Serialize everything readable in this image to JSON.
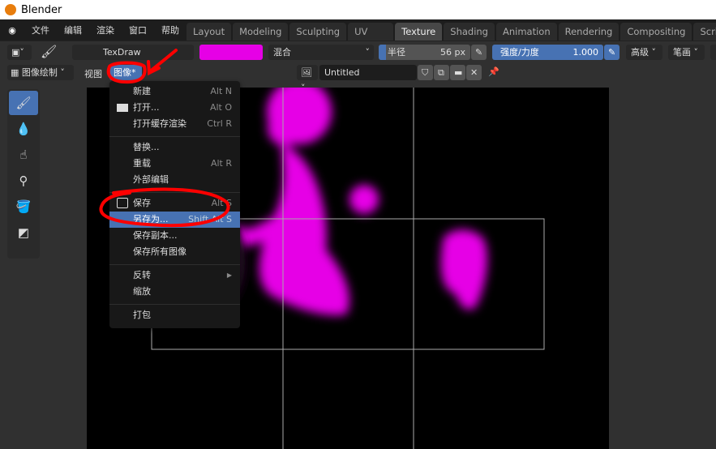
{
  "window": {
    "title": "Blender"
  },
  "menubar": [
    "文件",
    "编辑",
    "渲染",
    "窗口",
    "帮助"
  ],
  "workspaces": [
    "Layout",
    "Modeling",
    "Sculpting",
    "UV Editing",
    "Texture Paint",
    "Shading",
    "Animation",
    "Rendering",
    "Compositing",
    "Scri"
  ],
  "active_workspace": "Texture Paint",
  "tool_header": {
    "brush": "TexDraw",
    "color": "#e600e6",
    "blend": "混合",
    "radius_label": "半径",
    "radius_value": "56 px",
    "strength_label": "强度/力度",
    "strength_value": "1.000",
    "advanced": "高级",
    "stroke": "笔画"
  },
  "editor_header": {
    "mode": "图像绘制",
    "view": "视图",
    "image": "图像*",
    "image_name": "Untitled"
  },
  "image_menu": {
    "items": [
      {
        "label": "新建",
        "shortcut": "Alt N"
      },
      {
        "label": "打开...",
        "shortcut": "Alt O",
        "icon": "folder-icon"
      },
      {
        "label": "打开缓存渲染",
        "shortcut": "Ctrl R"
      },
      {
        "label": "替换...",
        "shortcut": ""
      },
      {
        "label": "重载",
        "shortcut": "Alt R"
      },
      {
        "label": "外部编辑",
        "shortcut": ""
      },
      {
        "label": "保存",
        "shortcut": "Alt S",
        "icon": "save-icon"
      },
      {
        "label": "另存为...",
        "shortcut": "Shift Alt S",
        "highlighted": true
      },
      {
        "label": "保存副本...",
        "shortcut": ""
      },
      {
        "label": "保存所有图像",
        "shortcut": ""
      },
      {
        "label": "反转",
        "shortcut": "",
        "submenu": true
      },
      {
        "label": "缩放",
        "shortcut": ""
      },
      {
        "label": "打包",
        "shortcut": ""
      }
    ]
  },
  "colors": {
    "accent": "#4772b3",
    "paint": "#e600e6",
    "annotation": "#ff0000"
  }
}
